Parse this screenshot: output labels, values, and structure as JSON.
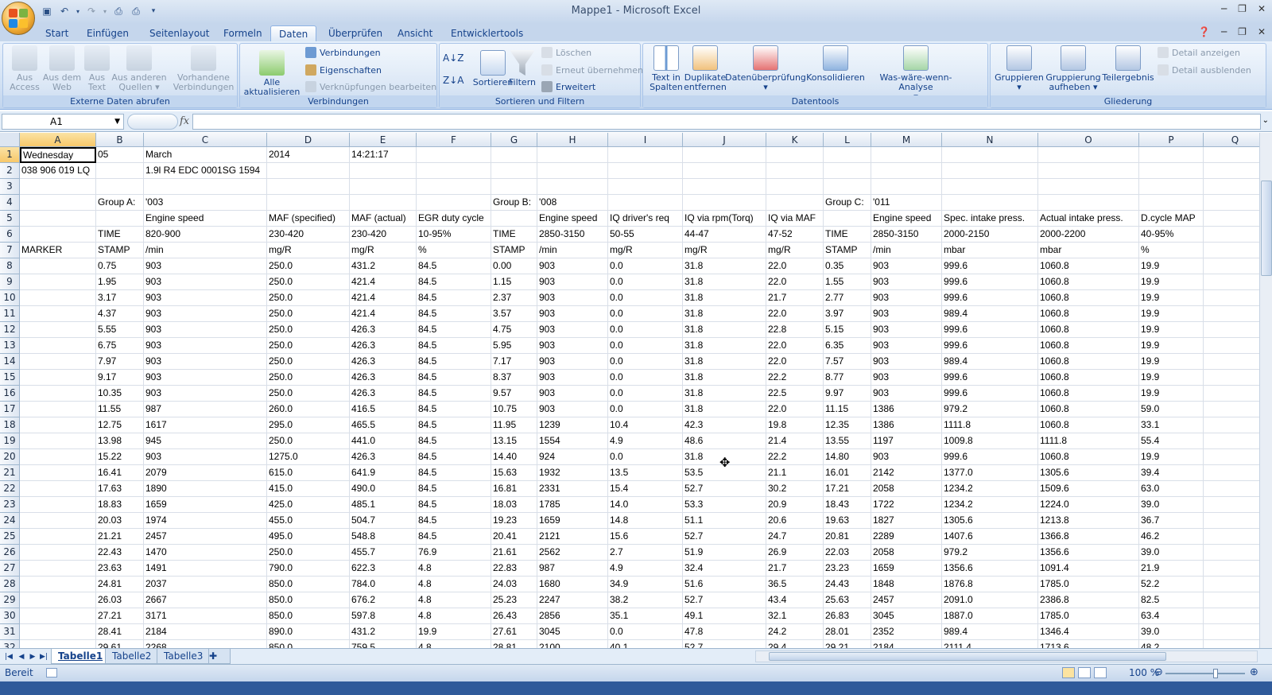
{
  "window": {
    "title": "Mappe1 - Microsoft Excel"
  },
  "tabs": [
    "Start",
    "Einfügen",
    "Seitenlayout",
    "Formeln",
    "Daten",
    "Überprüfen",
    "Ansicht",
    "Entwicklertools"
  ],
  "active_tab": "Daten",
  "ribbon": {
    "external": {
      "caption": "Externe Daten abrufen",
      "buttons": [
        {
          "l1": "Aus",
          "l2": "Access"
        },
        {
          "l1": "Aus dem",
          "l2": "Web"
        },
        {
          "l1": "Aus",
          "l2": "Text"
        },
        {
          "l1": "Aus anderen",
          "l2": "Quellen ▾"
        },
        {
          "l1": "Vorhandene",
          "l2": "Verbindungen"
        }
      ]
    },
    "connections": {
      "caption": "Verbindungen",
      "refresh": {
        "l1": "Alle",
        "l2": "aktualisieren ▾"
      },
      "small": [
        "Verbindungen",
        "Eigenschaften",
        "Verknüpfungen bearbeiten"
      ]
    },
    "sortfilter": {
      "caption": "Sortieren und Filtern",
      "sort": "Sortieren",
      "filter": "Filtern",
      "small": [
        "Löschen",
        "Erneut übernehmen",
        "Erweitert"
      ]
    },
    "datatools": {
      "caption": "Datentools",
      "buttons": [
        {
          "l1": "Text in",
          "l2": "Spalten"
        },
        {
          "l1": "Duplikate",
          "l2": "entfernen"
        },
        {
          "l1": "Datenüberprüfung",
          "l2": "▾"
        },
        {
          "l1": "Konsolidieren",
          "l2": ""
        },
        {
          "l1": "Was-wäre-wenn-Analyse",
          "l2": "▾"
        }
      ]
    },
    "outline": {
      "caption": "Gliederung",
      "buttons": [
        {
          "l1": "Gruppieren",
          "l2": "▾"
        },
        {
          "l1": "Gruppierung",
          "l2": "aufheben ▾"
        },
        {
          "l1": "Teilergebnis",
          "l2": ""
        }
      ],
      "small": [
        "Detail anzeigen",
        "Detail ausblenden"
      ]
    }
  },
  "formula_bar": {
    "name_box": "A1",
    "fx": "fx",
    "formula": ""
  },
  "columns": [
    "A",
    "B",
    "C",
    "D",
    "E",
    "F",
    "G",
    "H",
    "I",
    "J",
    "K",
    "L",
    "M",
    "N",
    "O",
    "P",
    "Q"
  ],
  "rows": [
    [
      "Wednesday",
      "05",
      "March",
      "2014",
      "14:21:17",
      "",
      "",
      "",
      "",
      "",
      "",
      "",
      "",
      "",
      "",
      "",
      ""
    ],
    [
      "038 906 019 LQ",
      "",
      "1.9l R4 EDC 0001SG  1594",
      "",
      "",
      "",
      "",
      "",
      "",
      "",
      "",
      "",
      "",
      "",
      "",
      "",
      ""
    ],
    [
      "",
      "",
      "",
      "",
      "",
      "",
      "",
      "",
      "",
      "",
      "",
      "",
      "",
      "",
      "",
      "",
      ""
    ],
    [
      "",
      "Group A:",
      "'003",
      "",
      "",
      "",
      "Group B:",
      "'008",
      "",
      "",
      "",
      "Group C:",
      "'011",
      "",
      "",
      "",
      ""
    ],
    [
      "",
      "",
      "Engine speed",
      "MAF (specified)",
      "MAF (actual)",
      "EGR duty cycle",
      "",
      "Engine speed",
      "IQ driver's req",
      "IQ via rpm(Torq)",
      "IQ via MAF",
      "",
      "Engine speed",
      "Spec. intake press.",
      "Actual intake press.",
      "D.cycle MAP",
      ""
    ],
    [
      "",
      "TIME",
      "820-900",
      "230-420",
      "230-420",
      "10-95%",
      "TIME",
      "2850-3150",
      "50-55",
      "44-47",
      "47-52",
      "TIME",
      "2850-3150",
      "2000-2150",
      "2000-2200",
      "40-95%",
      ""
    ],
    [
      "MARKER",
      "STAMP",
      " /min",
      " mg/R",
      " mg/R",
      " %",
      "STAMP",
      " /min",
      " mg/R",
      " mg/R",
      " mg/R",
      "STAMP",
      " /min",
      " mbar",
      " mbar",
      " %",
      ""
    ],
    [
      "",
      "0.75",
      "903",
      "250.0",
      "431.2",
      "84.5",
      "0.00",
      "903",
      "0.0",
      "31.8",
      "22.0",
      "0.35",
      "903",
      "999.6",
      "1060.8",
      "19.9",
      ""
    ],
    [
      "",
      "1.95",
      "903",
      "250.0",
      "421.4",
      "84.5",
      "1.15",
      "903",
      "0.0",
      "31.8",
      "22.0",
      "1.55",
      "903",
      "999.6",
      "1060.8",
      "19.9",
      ""
    ],
    [
      "",
      "3.17",
      "903",
      "250.0",
      "421.4",
      "84.5",
      "2.37",
      "903",
      "0.0",
      "31.8",
      "21.7",
      "2.77",
      "903",
      "999.6",
      "1060.8",
      "19.9",
      ""
    ],
    [
      "",
      "4.37",
      "903",
      "250.0",
      "421.4",
      "84.5",
      "3.57",
      "903",
      "0.0",
      "31.8",
      "22.0",
      "3.97",
      "903",
      "989.4",
      "1060.8",
      "19.9",
      ""
    ],
    [
      "",
      "5.55",
      "903",
      "250.0",
      "426.3",
      "84.5",
      "4.75",
      "903",
      "0.0",
      "31.8",
      "22.8",
      "5.15",
      "903",
      "999.6",
      "1060.8",
      "19.9",
      ""
    ],
    [
      "",
      "6.75",
      "903",
      "250.0",
      "426.3",
      "84.5",
      "5.95",
      "903",
      "0.0",
      "31.8",
      "22.0",
      "6.35",
      "903",
      "999.6",
      "1060.8",
      "19.9",
      ""
    ],
    [
      "",
      "7.97",
      "903",
      "250.0",
      "426.3",
      "84.5",
      "7.17",
      "903",
      "0.0",
      "31.8",
      "22.0",
      "7.57",
      "903",
      "989.4",
      "1060.8",
      "19.9",
      ""
    ],
    [
      "",
      "9.17",
      "903",
      "250.0",
      "426.3",
      "84.5",
      "8.37",
      "903",
      "0.0",
      "31.8",
      "22.2",
      "8.77",
      "903",
      "999.6",
      "1060.8",
      "19.9",
      ""
    ],
    [
      "",
      "10.35",
      "903",
      "250.0",
      "426.3",
      "84.5",
      "9.57",
      "903",
      "0.0",
      "31.8",
      "22.5",
      "9.97",
      "903",
      "999.6",
      "1060.8",
      "19.9",
      ""
    ],
    [
      "",
      "11.55",
      "987",
      "260.0",
      "416.5",
      "84.5",
      "10.75",
      "903",
      "0.0",
      "31.8",
      "22.0",
      "11.15",
      "1386",
      "979.2",
      "1060.8",
      "59.0",
      ""
    ],
    [
      "",
      "12.75",
      "1617",
      "295.0",
      "465.5",
      "84.5",
      "11.95",
      "1239",
      "10.4",
      "42.3",
      "19.8",
      "12.35",
      "1386",
      "1111.8",
      "1060.8",
      "33.1",
      ""
    ],
    [
      "",
      "13.98",
      "945",
      "250.0",
      "441.0",
      "84.5",
      "13.15",
      "1554",
      "4.9",
      "48.6",
      "21.4",
      "13.55",
      "1197",
      "1009.8",
      "1111.8",
      "55.4",
      ""
    ],
    [
      "",
      "15.22",
      "903",
      "1275.0",
      "426.3",
      "84.5",
      "14.40",
      "924",
      "0.0",
      "31.8",
      "22.2",
      "14.80",
      "903",
      "999.6",
      "1060.8",
      "19.9",
      ""
    ],
    [
      "",
      "16.41",
      "2079",
      "615.0",
      "641.9",
      "84.5",
      "15.63",
      "1932",
      "13.5",
      "53.5",
      "21.1",
      "16.01",
      "2142",
      "1377.0",
      "1305.6",
      "39.4",
      ""
    ],
    [
      "",
      "17.63",
      "1890",
      "415.0",
      "490.0",
      "84.5",
      "16.81",
      "2331",
      "15.4",
      "52.7",
      "30.2",
      "17.21",
      "2058",
      "1234.2",
      "1509.6",
      "63.0",
      ""
    ],
    [
      "",
      "18.83",
      "1659",
      "425.0",
      "485.1",
      "84.5",
      "18.03",
      "1785",
      "14.0",
      "53.3",
      "20.9",
      "18.43",
      "1722",
      "1234.2",
      "1224.0",
      "39.0",
      ""
    ],
    [
      "",
      "20.03",
      "1974",
      "455.0",
      "504.7",
      "84.5",
      "19.23",
      "1659",
      "14.8",
      "51.1",
      "20.6",
      "19.63",
      "1827",
      "1305.6",
      "1213.8",
      "36.7",
      ""
    ],
    [
      "",
      "21.21",
      "2457",
      "495.0",
      "548.8",
      "84.5",
      "20.41",
      "2121",
      "15.6",
      "52.7",
      "24.7",
      "20.81",
      "2289",
      "1407.6",
      "1366.8",
      "46.2",
      ""
    ],
    [
      "",
      "22.43",
      "1470",
      "250.0",
      "455.7",
      "76.9",
      "21.61",
      "2562",
      "2.7",
      "51.9",
      "26.9",
      "22.03",
      "2058",
      "979.2",
      "1356.6",
      "39.0",
      ""
    ],
    [
      "",
      "23.63",
      "1491",
      "790.0",
      "622.3",
      "4.8",
      "22.83",
      "987",
      "4.9",
      "32.4",
      "21.7",
      "23.23",
      "1659",
      "1356.6",
      "1091.4",
      "21.9",
      ""
    ],
    [
      "",
      "24.81",
      "2037",
      "850.0",
      "784.0",
      "4.8",
      "24.03",
      "1680",
      "34.9",
      "51.6",
      "36.5",
      "24.43",
      "1848",
      "1876.8",
      "1785.0",
      "52.2",
      ""
    ],
    [
      "",
      "26.03",
      "2667",
      "850.0",
      "676.2",
      "4.8",
      "25.23",
      "2247",
      "38.2",
      "52.7",
      "43.4",
      "25.63",
      "2457",
      "2091.0",
      "2386.8",
      "82.5",
      ""
    ],
    [
      "",
      "27.21",
      "3171",
      "850.0",
      "597.8",
      "4.8",
      "26.43",
      "2856",
      "35.1",
      "49.1",
      "32.1",
      "26.83",
      "3045",
      "1887.0",
      "1785.0",
      "63.4",
      ""
    ],
    [
      "",
      "28.41",
      "2184",
      "890.0",
      "431.2",
      "19.9",
      "27.61",
      "3045",
      "0.0",
      "47.8",
      "24.2",
      "28.01",
      "2352",
      "989.4",
      "1346.4",
      "39.0",
      ""
    ],
    [
      "",
      "29.61",
      "2268",
      "850.0",
      "759.5",
      "4.8",
      "28.81",
      "2100",
      "40.1",
      "52.7",
      "29.4",
      "29.21",
      "2184",
      "2111.4",
      "1713.6",
      "48.2",
      ""
    ]
  ],
  "sheets": [
    "Tabelle1",
    "Tabelle2",
    "Tabelle3"
  ],
  "active_sheet": "Tabelle1",
  "status": {
    "mode": "Bereit",
    "zoom": "100 %"
  }
}
